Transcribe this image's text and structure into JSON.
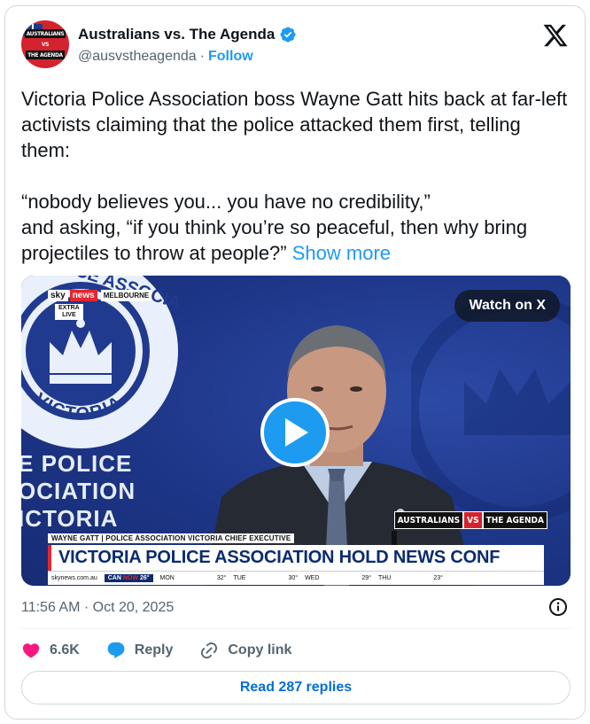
{
  "author": {
    "display_name": "Australians vs. The Agenda",
    "handle": "@ausvstheagenda",
    "separator": "·",
    "follow_label": "Follow",
    "avatar_lines": [
      "AUSTRALIANS",
      "VS",
      "THE AGENDA"
    ]
  },
  "tweet": {
    "paragraph1": "Victoria Police Association boss Wayne Gatt hits back at far-left activists claiming that the police attacked them first, telling them:",
    "paragraph2_line1": "“nobody believes you... you have no credibility,”",
    "paragraph2_line2": "and asking, “if you think you’re so peaceful, then why bring projectiles to throw at people?”",
    "show_more_label": "Show more"
  },
  "video": {
    "watch_label": "Watch on X",
    "channel_sky": "sky",
    "channel_news": "news",
    "channel_city": "MELBOURNE",
    "extra_label": "EXTRA",
    "live_label": "LIVE",
    "seal_top_text": "LICE ASSOCIATION",
    "seal_bottom_text": "VICTORIA",
    "wall_lines": [
      "E POLICE",
      "OCIATION",
      "ICTORIA"
    ],
    "caption": "WAYNE GATT | POLICE ASSOCIATION VICTORIA CHIEF EXECUTIVE",
    "headline": "VICTORIA POLICE ASSOCIATION HOLD NEWS CONF",
    "watermark": [
      "AUSTRALIANS",
      "VS",
      "THE AGENDA"
    ],
    "ticker": {
      "site": "skynews.com.au",
      "can_label": "CAN",
      "now_label": "NOW",
      "now_temp": "26°",
      "days": [
        {
          "day": "MON",
          "temp": "32°"
        },
        {
          "day": "TUE",
          "temp": "30°"
        },
        {
          "day": "WED",
          "temp": "29°"
        },
        {
          "day": "THU",
          "temp": "23°"
        }
      ]
    }
  },
  "timestamp": "11:56 AM · Oct 20, 2025",
  "actions": {
    "likes": "6.6K",
    "reply_label": "Reply",
    "copy_link_label": "Copy link"
  },
  "read_replies_label": "Read 287 replies",
  "colors": {
    "accent": "#1d9bf0",
    "like": "#f91880",
    "text": "#0f1419",
    "muted": "#536471",
    "border": "#cfd9de"
  }
}
